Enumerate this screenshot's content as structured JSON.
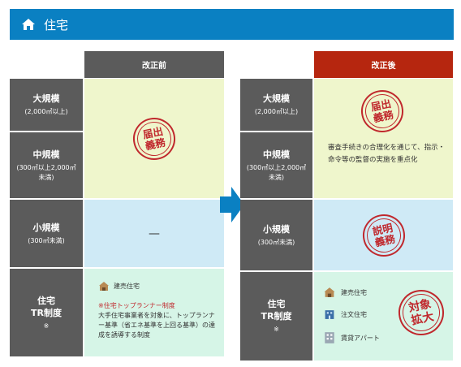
{
  "header": {
    "title": "住宅"
  },
  "before": {
    "column_title": "改正前",
    "rows": {
      "large": {
        "title": "大規模",
        "sub": "(2,000㎡以上)"
      },
      "medium": {
        "title": "中規模",
        "sub": "(300㎡以上2,000㎡未満)"
      },
      "small": {
        "title": "小規模",
        "sub": "(300㎡未満)"
      },
      "tr": {
        "title_line1": "住宅",
        "title_line2": "TR制度",
        "note": "※"
      }
    },
    "stamp_lines": [
      "届出",
      "義務"
    ],
    "small_value": "—",
    "tr_item": "建売住宅",
    "tr_red": "※住宅トップランナー制度",
    "tr_desc": "大手住宅事業者を対象に、トップランナー基準（省エネ基準を上回る基準）の達成を誘導する制度"
  },
  "after": {
    "column_title": "改正後",
    "rows": {
      "large": {
        "title": "大規模",
        "sub": "(2,000㎡以上)"
      },
      "medium": {
        "title": "中規模",
        "sub": "(300㎡以上2,000㎡未満)"
      },
      "small": {
        "title": "小規模",
        "sub": "(300㎡未満)"
      },
      "tr": {
        "title_line1": "住宅",
        "title_line2": "TR制度",
        "note": "※"
      }
    },
    "stamp_top_lines": [
      "届出",
      "義務"
    ],
    "mid_text": "審査手続きの合理化を通じて、指示・命令等の監督の実施を重点化",
    "stamp_small_lines": [
      "説明",
      "義務"
    ],
    "tr_items": [
      "建売住宅",
      "注文住宅",
      "賃貸アパート"
    ],
    "stamp_tr_lines": [
      "対象",
      "拡大"
    ]
  },
  "colors": {
    "header_bg": "#0a80c2",
    "before_header": "#5b5b5b",
    "after_header": "#b6260f",
    "yellow": "#eff6cc",
    "blue": "#cfeaf6",
    "mint": "#d6f5e7",
    "stamp_red": "#c0282d",
    "arrow": "#0a80c2"
  }
}
